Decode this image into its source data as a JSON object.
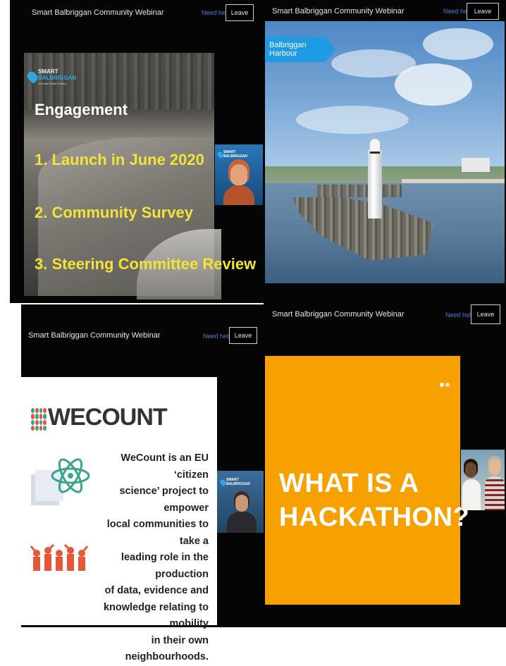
{
  "app": {
    "title": "Smart Balbriggan Community Webinar",
    "help_label": "Need help?",
    "leave_label": "Leave"
  },
  "panel1": {
    "logo_line1": "SMART",
    "logo_line2": "BALBRIGGAN",
    "logo_tagline": "A Smart Dublin Project",
    "heading": "Engagement",
    "items": [
      "1. Launch in June 2020",
      "2. Community Survey",
      "3. Steering Committee Review"
    ],
    "thumb_logo": "SMART BALBRIGGAN"
  },
  "panel2": {
    "location_tag": "Balbriggan Harbour"
  },
  "panel3": {
    "logo_text": "WECOUNT",
    "description_lines": [
      "WeCount is an EU ‘citizen",
      "science’ project to empower",
      "local communities to take a",
      "leading role in the production",
      "of data, evidence and",
      "knowledge relating to mobility",
      "in their own neighbourhoods."
    ],
    "thumb_logo": "SMART BALBRIGGAN"
  },
  "panel4": {
    "heading_line1": "WHAT IS A",
    "heading_line2": "HACKATHON?"
  },
  "colors": {
    "accent_blue": "#1e9be3",
    "slide_yellow": "#f3e23a",
    "hackathon_orange": "#f6a100",
    "wecount_teal": "#3aa58f",
    "wecount_red": "#e8563a"
  }
}
